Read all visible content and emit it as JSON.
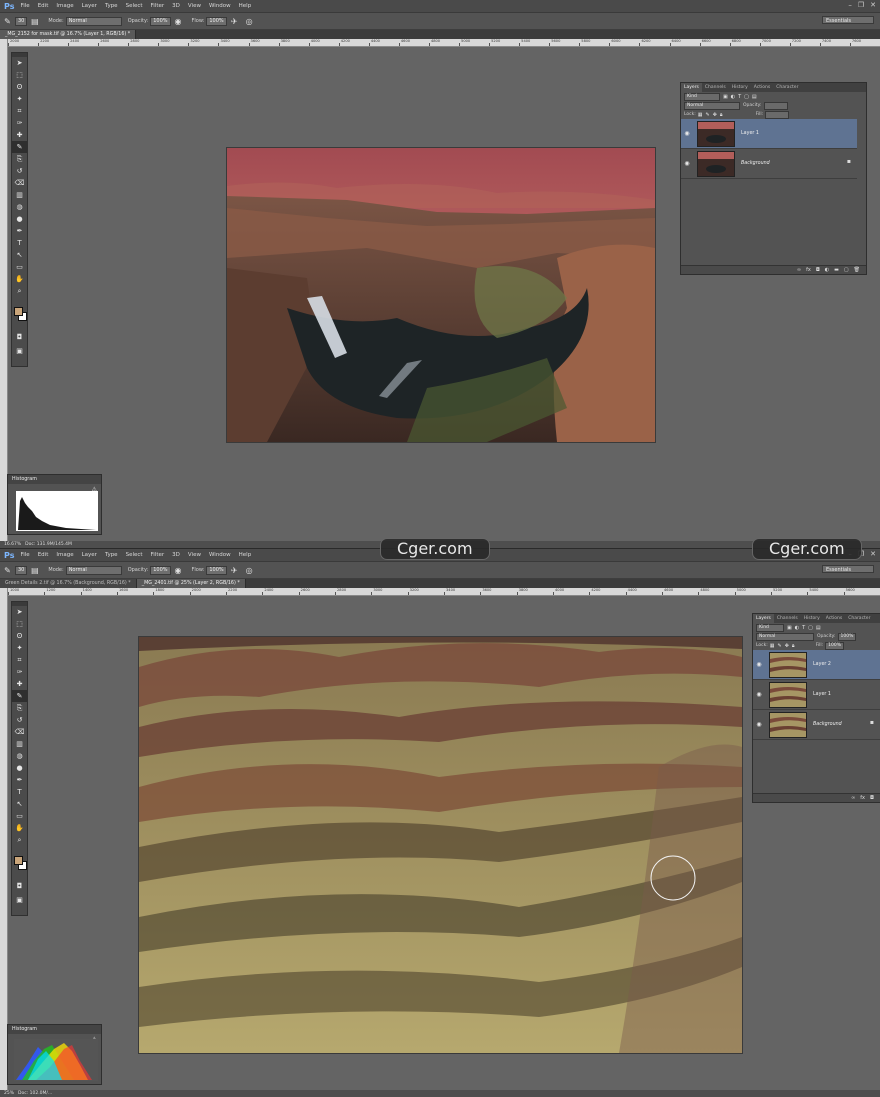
{
  "menu": {
    "logo": "Ps",
    "items": [
      "File",
      "Edit",
      "Image",
      "Layer",
      "Type",
      "Select",
      "Filter",
      "3D",
      "View",
      "Window",
      "Help"
    ]
  },
  "options": {
    "size": "30",
    "mode_label": "Mode:",
    "mode": "Normal",
    "opacity_label": "Opacity:",
    "opacity": "100%",
    "flow_label": "Flow:",
    "flow": "100%",
    "workspace": "Essentials"
  },
  "screen1": {
    "tabs": [
      "_MG_2152 for mask.tif @ 16.7% (Layer 1, RGB/16) *"
    ],
    "ruler_ticks": [
      "2000",
      "2200",
      "2400",
      "2600",
      "2800",
      "3000",
      "3200",
      "3400",
      "3600",
      "3800",
      "4000",
      "4200",
      "4400",
      "4600",
      "4800",
      "5000",
      "5200",
      "5400",
      "5600",
      "5800",
      "6000",
      "6200",
      "6400",
      "6600",
      "6800",
      "7000",
      "7200",
      "7400",
      "7600"
    ],
    "layers_panel": {
      "tabs": [
        "Layers",
        "Channels",
        "History",
        "Actions",
        "Character"
      ],
      "kind": "Kind",
      "blend": "Normal",
      "opacity_label": "Opacity:",
      "lock_label": "Lock:",
      "fill_label": "Fill:",
      "layers": [
        {
          "name": "Layer 1"
        },
        {
          "name": "Background"
        }
      ]
    },
    "histogram": {
      "title": "Histogram"
    },
    "status": {
      "zoom": "16.67%",
      "doc": "Doc: 131.9M/145.4M"
    }
  },
  "screen2": {
    "tabs": [
      "Green Details 2.tif @ 16.7% (Background, RGB/16) *",
      "_MG_2401.tif @ 25% (Layer 2, RGB/16) *"
    ],
    "ruler_ticks": [
      "1000",
      "1200",
      "1400",
      "1600",
      "1800",
      "2000",
      "2200",
      "2400",
      "2600",
      "2800",
      "3000",
      "3200",
      "3400",
      "3600",
      "3800",
      "4000",
      "4200",
      "4400",
      "4600",
      "4800",
      "5000",
      "5200",
      "5400",
      "5600"
    ],
    "layers_panel": {
      "tabs": [
        "Layers",
        "Channels",
        "History",
        "Actions",
        "Character"
      ],
      "kind": "Kind",
      "blend": "Normal",
      "opacity_label": "Opacity:",
      "opacity": "100%",
      "lock_label": "Lock:",
      "fill_label": "Fill:",
      "fill": "100%",
      "layers": [
        {
          "name": "Layer 2"
        },
        {
          "name": "Layer 1"
        },
        {
          "name": "Background"
        }
      ]
    },
    "histogram": {
      "title": "Histogram"
    },
    "status": {
      "zoom": "25%",
      "doc": "Doc: 102.0M/..."
    }
  },
  "watermarks": [
    "Cger.com",
    "Cger.com"
  ],
  "colors": {
    "foreground": "#c9a57a",
    "background": "#ffffff",
    "selected_layer": "#5f7392"
  },
  "icons": {
    "tools": [
      "move-icon",
      "marquee-icon",
      "lasso-icon",
      "quick-select-icon",
      "crop-icon",
      "eyedropper-icon",
      "healing-icon",
      "brush-icon",
      "clone-stamp-icon",
      "history-brush-icon",
      "eraser-icon",
      "gradient-icon",
      "blur-icon",
      "dodge-icon",
      "pen-icon",
      "type-icon",
      "path-select-icon",
      "shape-icon",
      "hand-icon",
      "zoom-icon"
    ]
  }
}
